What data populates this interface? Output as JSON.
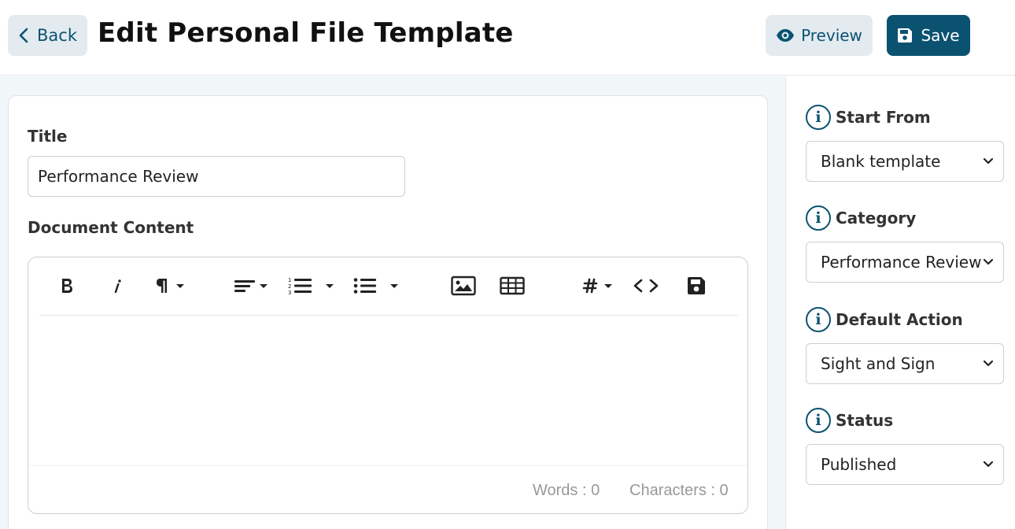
{
  "header": {
    "back_label": "Back",
    "title": "Edit Personal File Template",
    "preview_label": "Preview",
    "save_label": "Save"
  },
  "form": {
    "title_label": "Title",
    "title_value": "Performance Review",
    "content_label": "Document Content"
  },
  "editor": {
    "toolbar": [
      "bold-icon",
      "italic-icon",
      "paragraph-icon",
      "align-icon",
      "ordered-list-icon",
      "unordered-list-icon",
      "image-icon",
      "table-icon",
      "hashtag-icon",
      "code-icon",
      "save-icon"
    ],
    "footer": {
      "words": "Words : 0",
      "characters": "Characters : 0"
    }
  },
  "sidebar": {
    "start_from": {
      "label": "Start From",
      "value": "Blank template"
    },
    "category": {
      "label": "Category",
      "value": "Performance Review"
    },
    "default_action": {
      "label": "Default Action",
      "value": "Sight and Sign"
    },
    "status": {
      "label": "Status",
      "value": "Published"
    }
  },
  "colors": {
    "accent": "#0b5270",
    "light_button": "#e3ebf1",
    "background": "#f1f6f8"
  }
}
